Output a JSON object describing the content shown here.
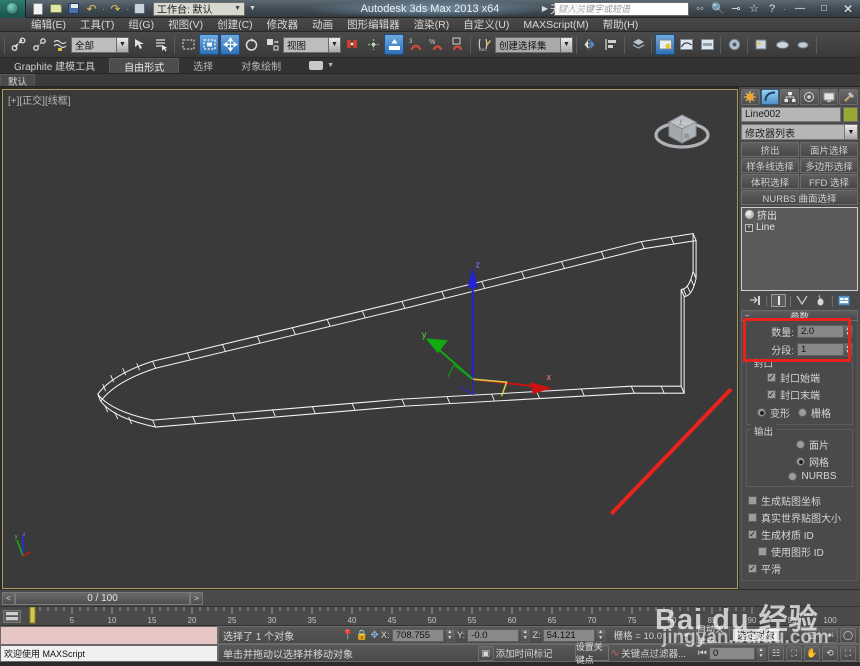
{
  "titlebar": {
    "app_title": "Autodesk 3ds Max  2013 x64",
    "file_name": "无标题",
    "workspace_label": "工作台: 默认",
    "search_placeholder": "键入关键字或短语",
    "quick_access": [
      "new-icon",
      "open-icon",
      "save-icon",
      "undo-icon",
      "redo-icon",
      "link-icon"
    ],
    "window_buttons": [
      "minimize",
      "maximize",
      "close"
    ],
    "help_icon": "?"
  },
  "menu": {
    "items": [
      "编辑(E)",
      "工具(T)",
      "组(G)",
      "视图(V)",
      "创建(C)",
      "修改器",
      "动画",
      "图形编辑器",
      "渲染(R)",
      "自定义(U)",
      "MAXScript(M)",
      "帮助(H)"
    ]
  },
  "toolbar": {
    "selection_filter": "全部",
    "reference_coord": "视图",
    "named_selection_set": "创建选择集",
    "items": [
      "select-link-icon",
      "unlink-icon",
      "bind-space-warp-icon",
      "select-object-icon",
      "select-by-name-icon",
      "rectangular-region-icon",
      "window-crossing-icon",
      "select-move-icon",
      "select-rotate-icon",
      "select-scale-icon",
      "use-pivot-icon",
      "mirror-icon",
      "align-icon",
      "snap-toggle-icon",
      "angle-snap-icon",
      "percent-snap-icon",
      "spinner-snap-icon",
      "edit-named-selection-icon",
      "mirror-axis-icon",
      "layer-manager-icon",
      "curve-editor-icon",
      "schematic-view-icon",
      "material-editor-icon",
      "render-setup-icon",
      "render-frame-icon",
      "render-production-icon",
      "quick-render-icon"
    ]
  },
  "ribbon": {
    "tabs": [
      {
        "label": "Graphite 建模工具",
        "active": false
      },
      {
        "label": "自由形式",
        "active": true
      },
      {
        "label": "选择",
        "active": false
      },
      {
        "label": "对象绘制",
        "active": false
      }
    ],
    "sub_tab": "默认"
  },
  "viewport": {
    "label": "[+][正交][线框]",
    "axis_labels": {
      "x": "x",
      "y": "y",
      "z": "z"
    },
    "viewcube_faces": [
      "上",
      "前"
    ]
  },
  "command_panel": {
    "tabs": [
      {
        "name": "create-tab",
        "active": false
      },
      {
        "name": "modify-tab",
        "active": true
      },
      {
        "name": "hierarchy-tab",
        "active": false
      },
      {
        "name": "motion-tab",
        "active": false
      },
      {
        "name": "display-tab",
        "active": false
      },
      {
        "name": "utilities-tab",
        "active": false
      }
    ],
    "object_name": "Line002",
    "object_color": "#9aa832",
    "modifier_list_label": "修改器列表",
    "modifier_buttons": [
      "挤出",
      "面片选择",
      "样条线选择",
      "多边形选择",
      "体积选择",
      "FFD 选择",
      "NURBS 曲面选择"
    ],
    "stack": [
      {
        "label": "挤出",
        "icon": "lightbulb-icon",
        "selected": true
      },
      {
        "label": "Line",
        "icon": "plus-box-icon",
        "selected": false
      }
    ],
    "stack_buttons": [
      "pin-stack-icon",
      "show-end-result-icon",
      "make-unique-icon",
      "remove-modifier-icon",
      "configure-sets-icon"
    ],
    "parameters": {
      "title": "参数",
      "amount_label": "数量:",
      "amount_value": "2.0",
      "segments_label": "分段:",
      "segments_value": "1",
      "capping_group": "封口",
      "cap_start_label": "封口始端",
      "cap_start_checked": true,
      "cap_end_label": "封口末端",
      "cap_end_checked": true,
      "morph_label": "变形",
      "grid_label": "栅格",
      "cap_type_selected": "变形",
      "output_group": "输出",
      "output_options": [
        "面片",
        "网格",
        "NURBS"
      ],
      "output_selected": "网格",
      "gen_mapping_label": "生成贴图坐标",
      "gen_mapping_checked": false,
      "real_world_label": "真实世界贴图大小",
      "real_world_checked": false,
      "gen_matid_label": "生成材质 ID",
      "gen_matid_checked": true,
      "use_shapeid_label": "使用图形 ID",
      "use_shapeid_checked": false,
      "smooth_label": "平滑",
      "smooth_checked": true
    },
    "highlight_color": "#e8221c"
  },
  "timeline": {
    "current_frame": "0 / 100",
    "prev_label": "<",
    "next_label": ">",
    "ticks": [
      "5",
      "10",
      "15",
      "20",
      "25",
      "30",
      "35",
      "40",
      "45",
      "50",
      "55",
      "60",
      "65",
      "70",
      "75",
      "80",
      "85",
      "90",
      "95",
      "100"
    ]
  },
  "status": {
    "selection_text": "选择了 1 个对象",
    "prompt_text": "单击并拖动以选择并移动对象",
    "maxscript_label": "欢迎使用  MAXScript",
    "coord_x_label": "X:",
    "coord_x_value": "708.755",
    "coord_y_label": "Y:",
    "coord_y_value": "-0.0",
    "coord_z_label": "Z:",
    "coord_z_value": "54.121",
    "grid_label": "栅格 = 10.0",
    "add_time_tag": "添加时间标记",
    "auto_key": "自动关键点",
    "set_key": "设置关键点",
    "selected_objects": "选定对象",
    "key_filters": "关键点过滤器...",
    "frame_field": "0"
  },
  "watermark": {
    "line1": "Bai du 经验",
    "line2": "jingyan.baidu.com"
  }
}
